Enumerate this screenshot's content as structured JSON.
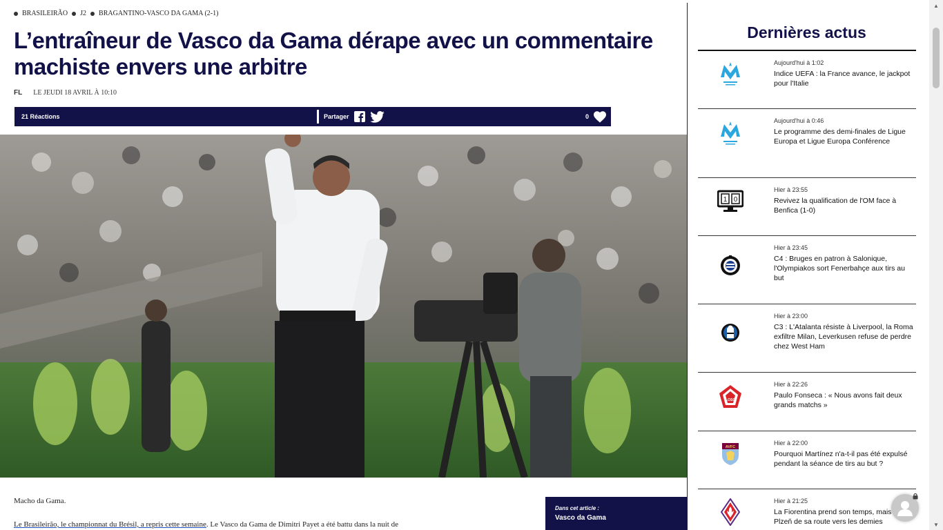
{
  "breadcrumb": {
    "items": [
      "Brasileirão",
      "J2",
      "Bragantino-Vasco da Gama (2-1)"
    ]
  },
  "article": {
    "title": "L’entraîneur de Vasco da Gama dérape avec un commentaire machiste envers une arbitre",
    "author": "FL",
    "date": "Le jeudi 18 avril à 10:10",
    "reactions": "21 Réactions",
    "share_label": "Partager",
    "like_count": "0",
    "intro": "Macho da Gama.",
    "body_link": "Le Brasileirão, le championnat du Brésil, a repris cette semaine",
    "body_rest": ". Le Vasco da Gama de Dimitri Payet a été battu dans la nuit de",
    "in_article_label": "Dans cet article :",
    "in_article_value": "Vasco da Gama"
  },
  "sidebar": {
    "title": "Dernières actus",
    "items": [
      {
        "time": "Aujourd'hui à 1:02",
        "headline": "Indice UEFA : la France avance, le jackpot pour l'Italie",
        "logo": "om-crest-icon"
      },
      {
        "time": "Aujourd'hui à 0:46",
        "headline": "Le programme des demi-finales de Ligue Europa et Ligue Europa Conférence",
        "logo": "om-crest-icon"
      },
      {
        "time": "Hier à 23:55",
        "headline": "Revivez la qualification de l'OM face à Benfica (1-0)",
        "logo": "scoreboard-icon"
      },
      {
        "time": "Hier à 23:45",
        "headline": "C4 : Bruges en patron à Salonique, l'Olympiakos sort Fenerbahçe aux tirs au but",
        "logo": "club-brugge-crest-icon"
      },
      {
        "time": "Hier à 23:00",
        "headline": "C3 : L'Atalanta résiste à Liverpool, la Roma exfiltre Milan, Leverkusen refuse de perdre chez West Ham",
        "logo": "atalanta-crest-icon"
      },
      {
        "time": "Hier à 22:26",
        "headline": "Paulo Fonseca : « Nous avons fait deux grands matchs »",
        "logo": "losc-crest-icon"
      },
      {
        "time": "Hier à 22:00",
        "headline": "Pourquoi Martínez n'a-t-il pas été expulsé pendant la séance de tirs au but ?",
        "logo": "aston-villa-crest-icon"
      },
      {
        "time": "Hier à 21:25",
        "headline": "La Fiorentina prend son temps, mais écarte Plzeň de sa route vers les demies",
        "logo": "fiorentina-crest-icon"
      }
    ]
  },
  "colors": {
    "brand_navy": "#121249",
    "om_blue": "#2aa7df",
    "losc_red": "#d9252a",
    "villa_claret": "#7a003c",
    "villa_blue": "#95bfe5",
    "fiorentina_purple": "#5b2c86"
  }
}
